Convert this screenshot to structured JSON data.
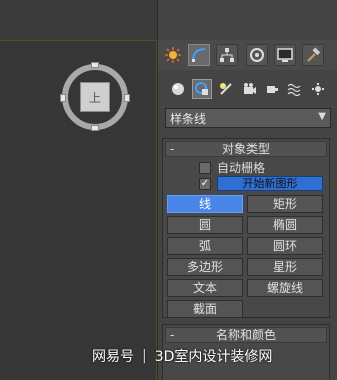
{
  "panel": {
    "tabs": [
      {
        "icon": "sun-create-icon"
      },
      {
        "icon": "curve-modify-icon"
      },
      {
        "icon": "hierarchy-icon"
      },
      {
        "icon": "motion-icon"
      },
      {
        "icon": "display-icon"
      },
      {
        "icon": "hammer-utilities-icon"
      }
    ],
    "subcategories": [
      {
        "icon": "geometry-sphere-icon"
      },
      {
        "icon": "shapes-icon"
      },
      {
        "icon": "lights-icon"
      },
      {
        "icon": "cameras-icon"
      },
      {
        "icon": "helpers-icon"
      },
      {
        "icon": "spacewarps-icon"
      },
      {
        "icon": "systems-icon"
      }
    ],
    "dropdown": {
      "selected": "样条线"
    },
    "object_type": {
      "title": "对象类型",
      "collapse": "-",
      "auto_grid_label": "自动栅格",
      "start_new_shape_label": "开始新图形",
      "start_new_checked": "✓",
      "buttons": [
        {
          "label": "线",
          "active": true
        },
        {
          "label": "矩形"
        },
        {
          "label": "圆"
        },
        {
          "label": "椭圆"
        },
        {
          "label": "弧"
        },
        {
          "label": "圆环"
        },
        {
          "label": "多边形"
        },
        {
          "label": "星形"
        },
        {
          "label": "文本"
        },
        {
          "label": "螺旋线"
        },
        {
          "label": "截面"
        }
      ]
    },
    "name_color": {
      "title": "名称和颜色",
      "collapse": "-"
    }
  },
  "viewcube": {
    "face_label": "上"
  },
  "watermark": {
    "left": "网易号",
    "separator": "|",
    "right": "3D室内设计装修网"
  },
  "colors": {
    "active_button": "#4a86e8",
    "start_new_field": "#2f6fd3",
    "panel_bg": "#444444"
  }
}
